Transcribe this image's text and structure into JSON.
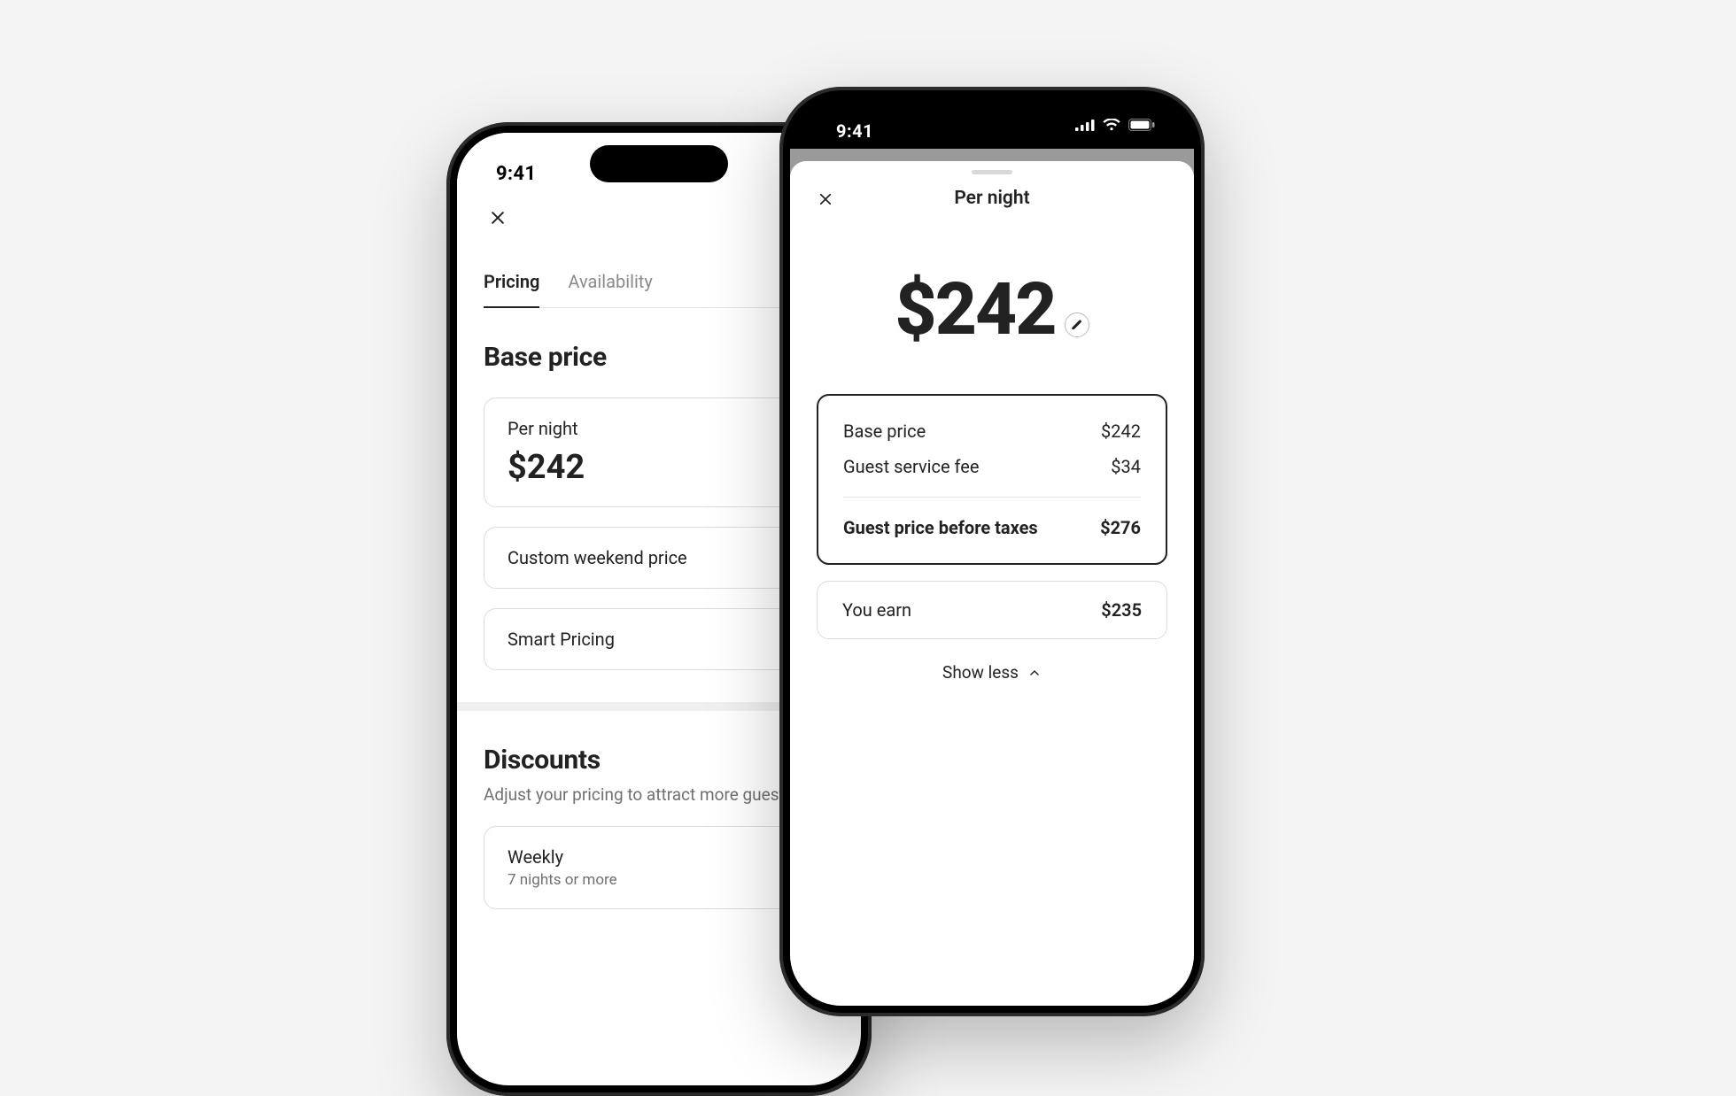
{
  "status": {
    "time": "9:41"
  },
  "left": {
    "tabs": {
      "pricing": "Pricing",
      "availability": "Availability"
    },
    "base_price_title": "Base price",
    "per_night": {
      "label": "Per night",
      "amount": "$242"
    },
    "custom_weekend": {
      "label": "Custom weekend price"
    },
    "smart_pricing": {
      "label": "Smart Pricing"
    },
    "discounts": {
      "title": "Discounts",
      "subtitle": "Adjust your pricing to attract more guests",
      "weekly": {
        "label": "Weekly",
        "sub": "7 nights or more"
      }
    }
  },
  "right": {
    "sheet_title": "Per night",
    "hero_amount": "$242",
    "breakdown": {
      "base": {
        "label": "Base price",
        "value": "$242"
      },
      "fee": {
        "label": "Guest service fee",
        "value": "$34"
      },
      "total": {
        "label": "Guest price before taxes",
        "value": "$276"
      }
    },
    "earn": {
      "label": "You earn",
      "value": "$235"
    },
    "show_less": "Show less"
  }
}
